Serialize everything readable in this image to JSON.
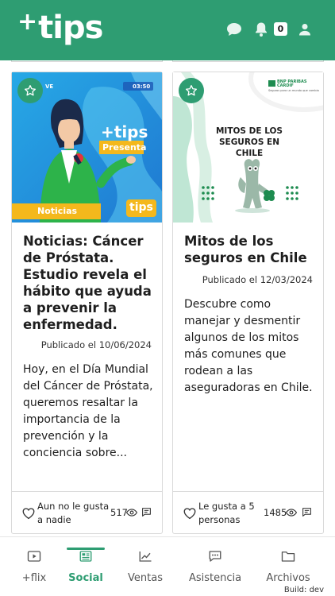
{
  "header": {
    "logo_plus": "+",
    "logo_text": "tips",
    "notification_count": "0",
    "icons": [
      "chat-icon",
      "bell-icon",
      "user-icon"
    ]
  },
  "cards": [
    {
      "image": {
        "live_label": "VE",
        "time_label": "03:50",
        "brand_plus_tips": "+tips",
        "presenta_label": "Presenta",
        "noticias_label": "Noticias",
        "tips_badge": "tips"
      },
      "title": "Noticias: Cáncer de Próstata. Estudio revela el hábito que ayuda a prevenir la enfermedad.",
      "published": "Publicado el 10/06/2024",
      "description": "Hoy, en el Día Mundial del Cáncer de Próstata, queremos resaltar la importancia de la prevención y la conciencia sobre...",
      "likes": "Aun no le gusta a nadie",
      "views": "517"
    },
    {
      "image": {
        "bank_name": "BNP PARIBAS CARDIF",
        "bank_tagline": "Seguros para un mundo que cambia",
        "headline": "MITOS DE LOS SEGUROS EN CHILE"
      },
      "title": "Mitos de los seguros en Chile",
      "published": "Publicado el 12/03/2024",
      "description": "Descubre como manejar y desmentir algunos de los mitos más comunes que rodean a las aseguradoras en Chile.",
      "likes": "Le gusta a 5 personas",
      "views": "1485"
    }
  ],
  "nav": {
    "items": [
      {
        "label": "+flix",
        "icon": "video-icon"
      },
      {
        "label": "Social",
        "icon": "newspaper-icon"
      },
      {
        "label": "Ventas",
        "icon": "chart-icon"
      },
      {
        "label": "Asistencia",
        "icon": "message-icon"
      },
      {
        "label": "Archivos",
        "icon": "folder-icon"
      }
    ],
    "active": "Social"
  },
  "build_label": "Build: dev",
  "colors": {
    "brand_green": "#2e9d72",
    "card_border": "#d9d9d9",
    "text": "#1e1e1e"
  }
}
